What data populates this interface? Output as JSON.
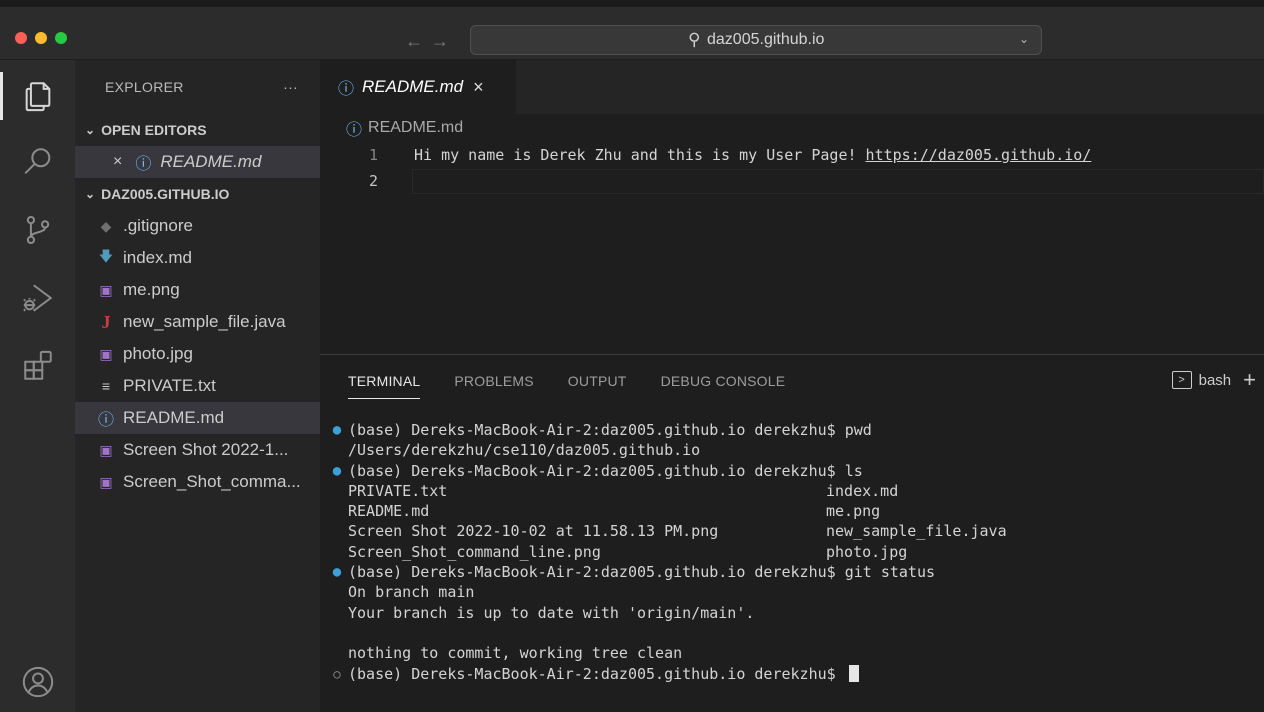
{
  "window": {
    "search_text": "daz005.github.io",
    "nav_back": "←",
    "nav_forward": "→"
  },
  "activity_bar": {
    "items": [
      "explorer-icon",
      "search-icon",
      "source-control-icon",
      "run-debug-icon",
      "extensions-icon",
      "account-icon"
    ]
  },
  "sidebar": {
    "title": "EXPLORER",
    "more": "···",
    "open_editors_title": "OPEN EDITORS",
    "open_editors": [
      {
        "name": "README.md",
        "icon": "info-icon"
      }
    ],
    "folder_title": "DAZ005.GITHUB.IO",
    "files": [
      {
        "name": ".gitignore",
        "icon": "git-icon"
      },
      {
        "name": "index.md",
        "icon": "markdown-icon"
      },
      {
        "name": "me.png",
        "icon": "image-icon"
      },
      {
        "name": "new_sample_file.java",
        "icon": "java-icon"
      },
      {
        "name": "photo.jpg",
        "icon": "image-icon"
      },
      {
        "name": "PRIVATE.txt",
        "icon": "text-file-icon"
      },
      {
        "name": "README.md",
        "icon": "info-icon",
        "selected": true
      },
      {
        "name": "Screen Shot 2022-1...",
        "icon": "image-icon"
      },
      {
        "name": "Screen_Shot_comma...",
        "icon": "image-icon"
      }
    ]
  },
  "editor": {
    "tab_title": "README.md",
    "tab_close": "×",
    "breadcrumb": "README.md",
    "lines": [
      {
        "num": "1",
        "text": "Hi my name is Derek Zhu and this is my User Page! ",
        "link": "https://daz005.github.io/"
      },
      {
        "num": "2",
        "text": "",
        "link": ""
      }
    ]
  },
  "panel": {
    "tabs": [
      "TERMINAL",
      "PROBLEMS",
      "OUTPUT",
      "DEBUG CONSOLE"
    ],
    "active_tab": "TERMINAL",
    "shell_label": "bash",
    "terminal_lines": [
      {
        "mark": "blue",
        "text": "(base) Dereks-MacBook-Air-2:daz005.github.io derekzhu$ pwd",
        "col2": ""
      },
      {
        "mark": "",
        "text": "/Users/derekzhu/cse110/daz005.github.io",
        "col2": ""
      },
      {
        "mark": "blue",
        "text": "(base) Dereks-MacBook-Air-2:daz005.github.io derekzhu$ ls",
        "col2": ""
      },
      {
        "mark": "",
        "text": "PRIVATE.txt",
        "col2": "index.md"
      },
      {
        "mark": "",
        "text": "README.md",
        "col2": "me.png"
      },
      {
        "mark": "",
        "text": "Screen Shot 2022-10-02 at 11.58.13 PM.png",
        "col2": "new_sample_file.java"
      },
      {
        "mark": "",
        "text": "Screen_Shot_command_line.png",
        "col2": "photo.jpg"
      },
      {
        "mark": "blue",
        "text": "(base) Dereks-MacBook-Air-2:daz005.github.io derekzhu$ git status",
        "col2": ""
      },
      {
        "mark": "",
        "text": "On branch main",
        "col2": ""
      },
      {
        "mark": "",
        "text": "Your branch is up to date with 'origin/main'.",
        "col2": ""
      },
      {
        "mark": "",
        "text": "",
        "col2": ""
      },
      {
        "mark": "",
        "text": "nothing to commit, working tree clean",
        "col2": ""
      },
      {
        "mark": "hollow",
        "text": "(base) Dereks-MacBook-Air-2:daz005.github.io derekzhu$ ",
        "col2": "",
        "cursor": true
      }
    ]
  },
  "colors": {
    "accent_blue": "#3c9fd6",
    "background": "#1e1e1e",
    "sidebar": "#252526"
  }
}
